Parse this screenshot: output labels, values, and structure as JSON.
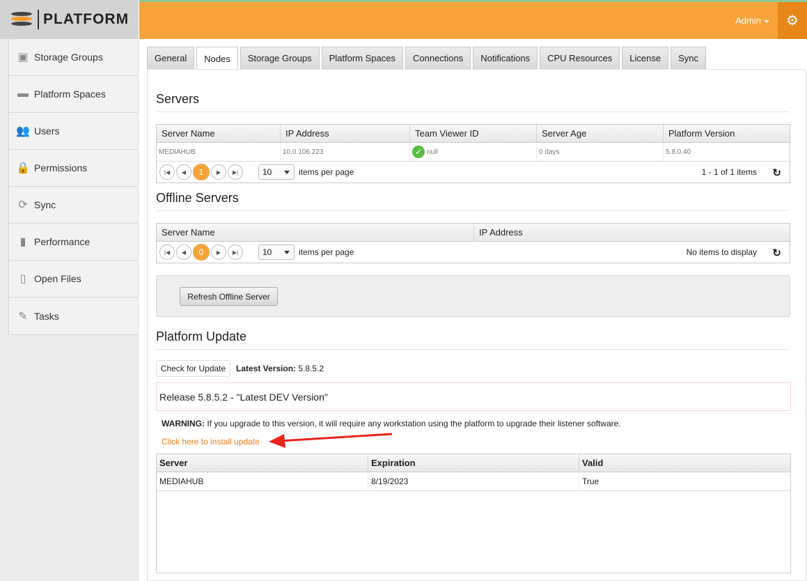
{
  "app": {
    "logo_text": "PLATFORM",
    "user_menu": "Admin",
    "accent": "#f7a33a",
    "accent_dark": "#e8861a"
  },
  "sidebar": {
    "items": [
      {
        "label": "Storage Groups",
        "icon": "storage-icon"
      },
      {
        "label": "Platform Spaces",
        "icon": "folder-icon"
      },
      {
        "label": "Users",
        "icon": "users-icon"
      },
      {
        "label": "Permissions",
        "icon": "lock-icon"
      },
      {
        "label": "Sync",
        "icon": "sync-icon"
      },
      {
        "label": "Performance",
        "icon": "bar-chart-icon"
      },
      {
        "label": "Open Files",
        "icon": "file-lock-icon"
      },
      {
        "label": "Tasks",
        "icon": "tasks-icon"
      }
    ]
  },
  "tabs": [
    "General",
    "Nodes",
    "Storage Groups",
    "Platform Spaces",
    "Connections",
    "Notifications",
    "CPU Resources",
    "License",
    "Sync"
  ],
  "active_tab": "Nodes",
  "servers": {
    "title": "Servers",
    "columns": [
      "Server Name",
      "IP Address",
      "Team Viewer ID",
      "Server Age",
      "Platform Version"
    ],
    "rows": [
      {
        "name": "MEDIAHUB",
        "ip": "10.0.106.223",
        "teamviewer": "null",
        "age": "0 days",
        "version": "5.8.0.40"
      }
    ],
    "pager": {
      "page": "1",
      "per_page": "10",
      "per_page_label": "items per page",
      "info": "1 - 1 of 1 items"
    }
  },
  "offline": {
    "title": "Offline Servers",
    "columns": [
      "Server Name",
      "IP Address"
    ],
    "pager": {
      "page": "0",
      "per_page": "10",
      "per_page_label": "items per page",
      "info": "No items to display"
    },
    "refresh_button": "Refresh Offline Server"
  },
  "update": {
    "title": "Platform Update",
    "check_button": "Check for Update",
    "latest_label": "Latest Version:",
    "latest_value": "5.8.5.2",
    "release_text": "Release 5.8.5.2 - \"Latest DEV Version\"",
    "warning_label": "WARNING:",
    "warning_text": "If you upgrade to this version, it will require any workstation using the platform to upgrade their listener software.",
    "install_link": "Click here to install update"
  },
  "license": {
    "columns": [
      "Server",
      "Expiration",
      "Valid"
    ],
    "rows": [
      {
        "server": "MEDIAHUB",
        "expiration": "8/19/2023",
        "valid": "True"
      }
    ]
  }
}
